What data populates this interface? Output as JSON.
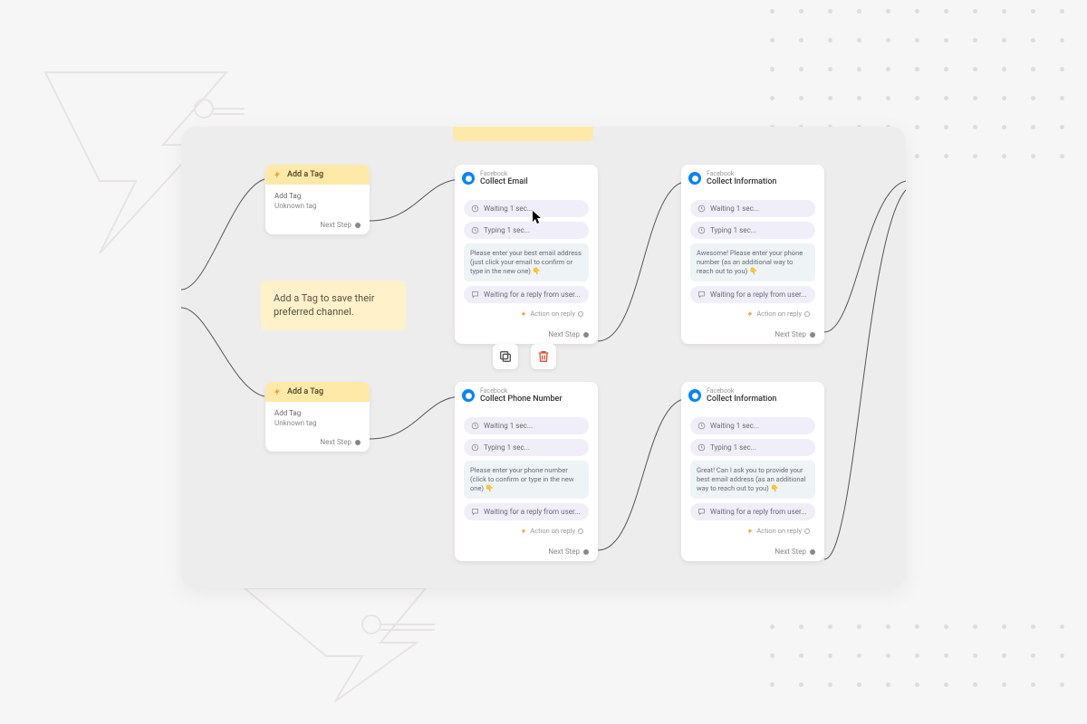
{
  "note": {
    "text": "Add a Tag to save their preferred channel."
  },
  "tagNode1": {
    "title": "Add a Tag",
    "body_label": "Add Tag",
    "body_value": "Unknown tag",
    "next": "Next Step"
  },
  "tagNode2": {
    "title": "Add a Tag",
    "body_label": "Add Tag",
    "body_value": "Unknown tag",
    "next": "Next Step"
  },
  "collectEmail": {
    "platform": "Facebook",
    "title": "Collect Email",
    "waiting": "Waiting 1 sec...",
    "typing": "Typing 1 sec...",
    "message": "Please enter your best email address (just click your email to confirm or type in the new one) 👇",
    "waiting_reply": "Waiting for a reply from user...",
    "action": "Action on reply",
    "next": "Next Step"
  },
  "collectPhone": {
    "platform": "Facebook",
    "title": "Collect Phone Number",
    "waiting": "Waiting 1 sec...",
    "typing": "Typing 1 sec...",
    "message": "Please enter your phone number (click to confirm or type in the new one) 👇",
    "waiting_reply": "Waiting for a reply from user...",
    "action": "Action on reply",
    "next": "Next Step"
  },
  "collectInfo1": {
    "platform": "Facebook",
    "title": "Collect Information",
    "waiting": "Waiting 1 sec...",
    "typing": "Typing 1 sec...",
    "message": "Awesome! Please enter your phone number (as an additional way to reach out to you) 👇",
    "waiting_reply": "Waiting for a reply from user...",
    "action": "Action on reply",
    "next": "Next Step"
  },
  "collectInfo2": {
    "platform": "Facebook",
    "title": "Collect Information",
    "waiting": "Waiting 1 sec...",
    "typing": "Typing 1 sec...",
    "message": "Great! Can I ask you to provide your best email address (as an additional way to reach out to you) 👇",
    "waiting_reply": "Waiting for a reply from user...",
    "action": "Action on reply",
    "next": "Next Step"
  }
}
